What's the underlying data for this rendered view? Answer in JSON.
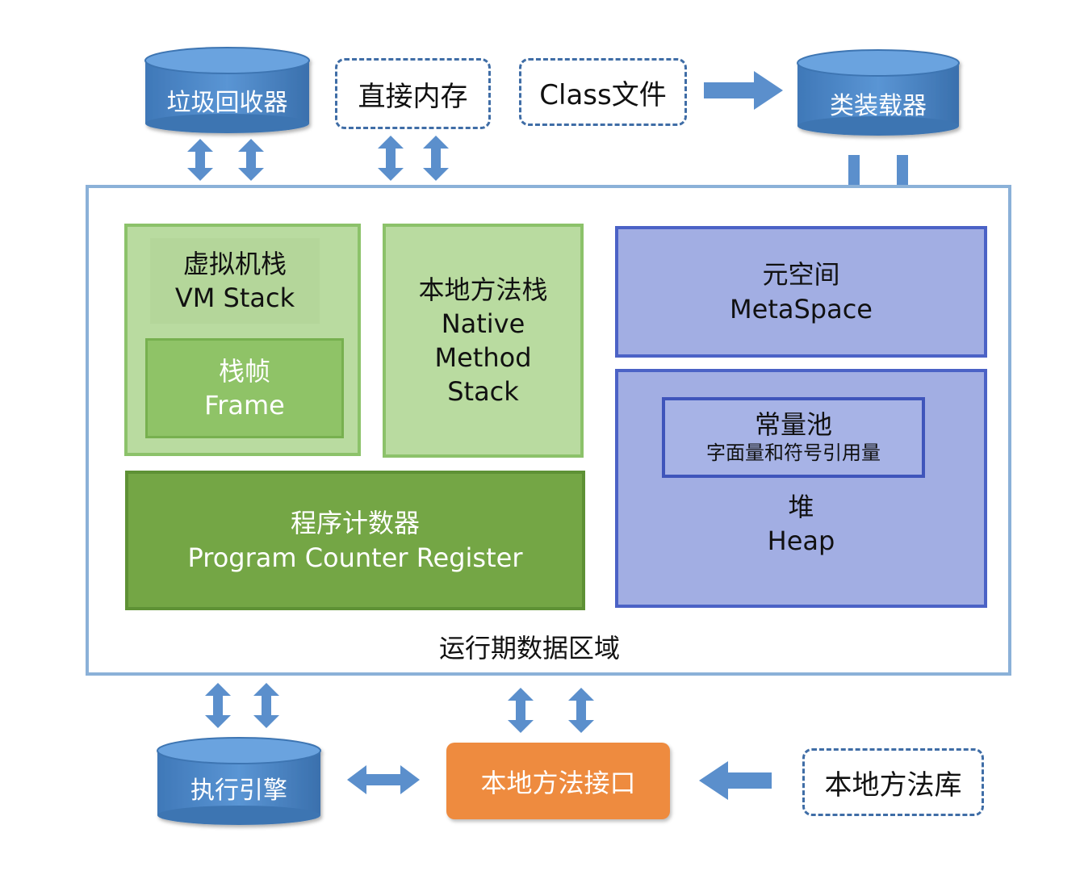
{
  "top": {
    "garbage_collector": "垃圾回收器",
    "direct_memory": "直接内存",
    "class_file": "Class文件",
    "class_loader": "类装载器"
  },
  "runtime": {
    "vm_stack": {
      "cn": "虚拟机栈",
      "en": "VM Stack"
    },
    "frame": {
      "cn": "栈帧",
      "en": "Frame"
    },
    "native_stack": {
      "cn": "本地方法栈",
      "en1": "Native",
      "en2": "Method",
      "en3": "Stack"
    },
    "pc": {
      "cn": "程序计数器",
      "en": "Program Counter Register"
    },
    "metaspace": {
      "cn": "元空间",
      "en": "MetaSpace"
    },
    "constant_pool": {
      "cn": "常量池",
      "sub": "字面量和符号引用量"
    },
    "heap": {
      "cn": "堆",
      "en": "Heap"
    },
    "area_label": "运行期数据区域"
  },
  "bottom": {
    "execution_engine": "执行引擎",
    "native_interface": "本地方法接口",
    "native_library": "本地方法库"
  },
  "colors": {
    "cylinder": "#4a86c6",
    "arrow": "#5b8fcc",
    "orange": "#ee8b3f"
  }
}
